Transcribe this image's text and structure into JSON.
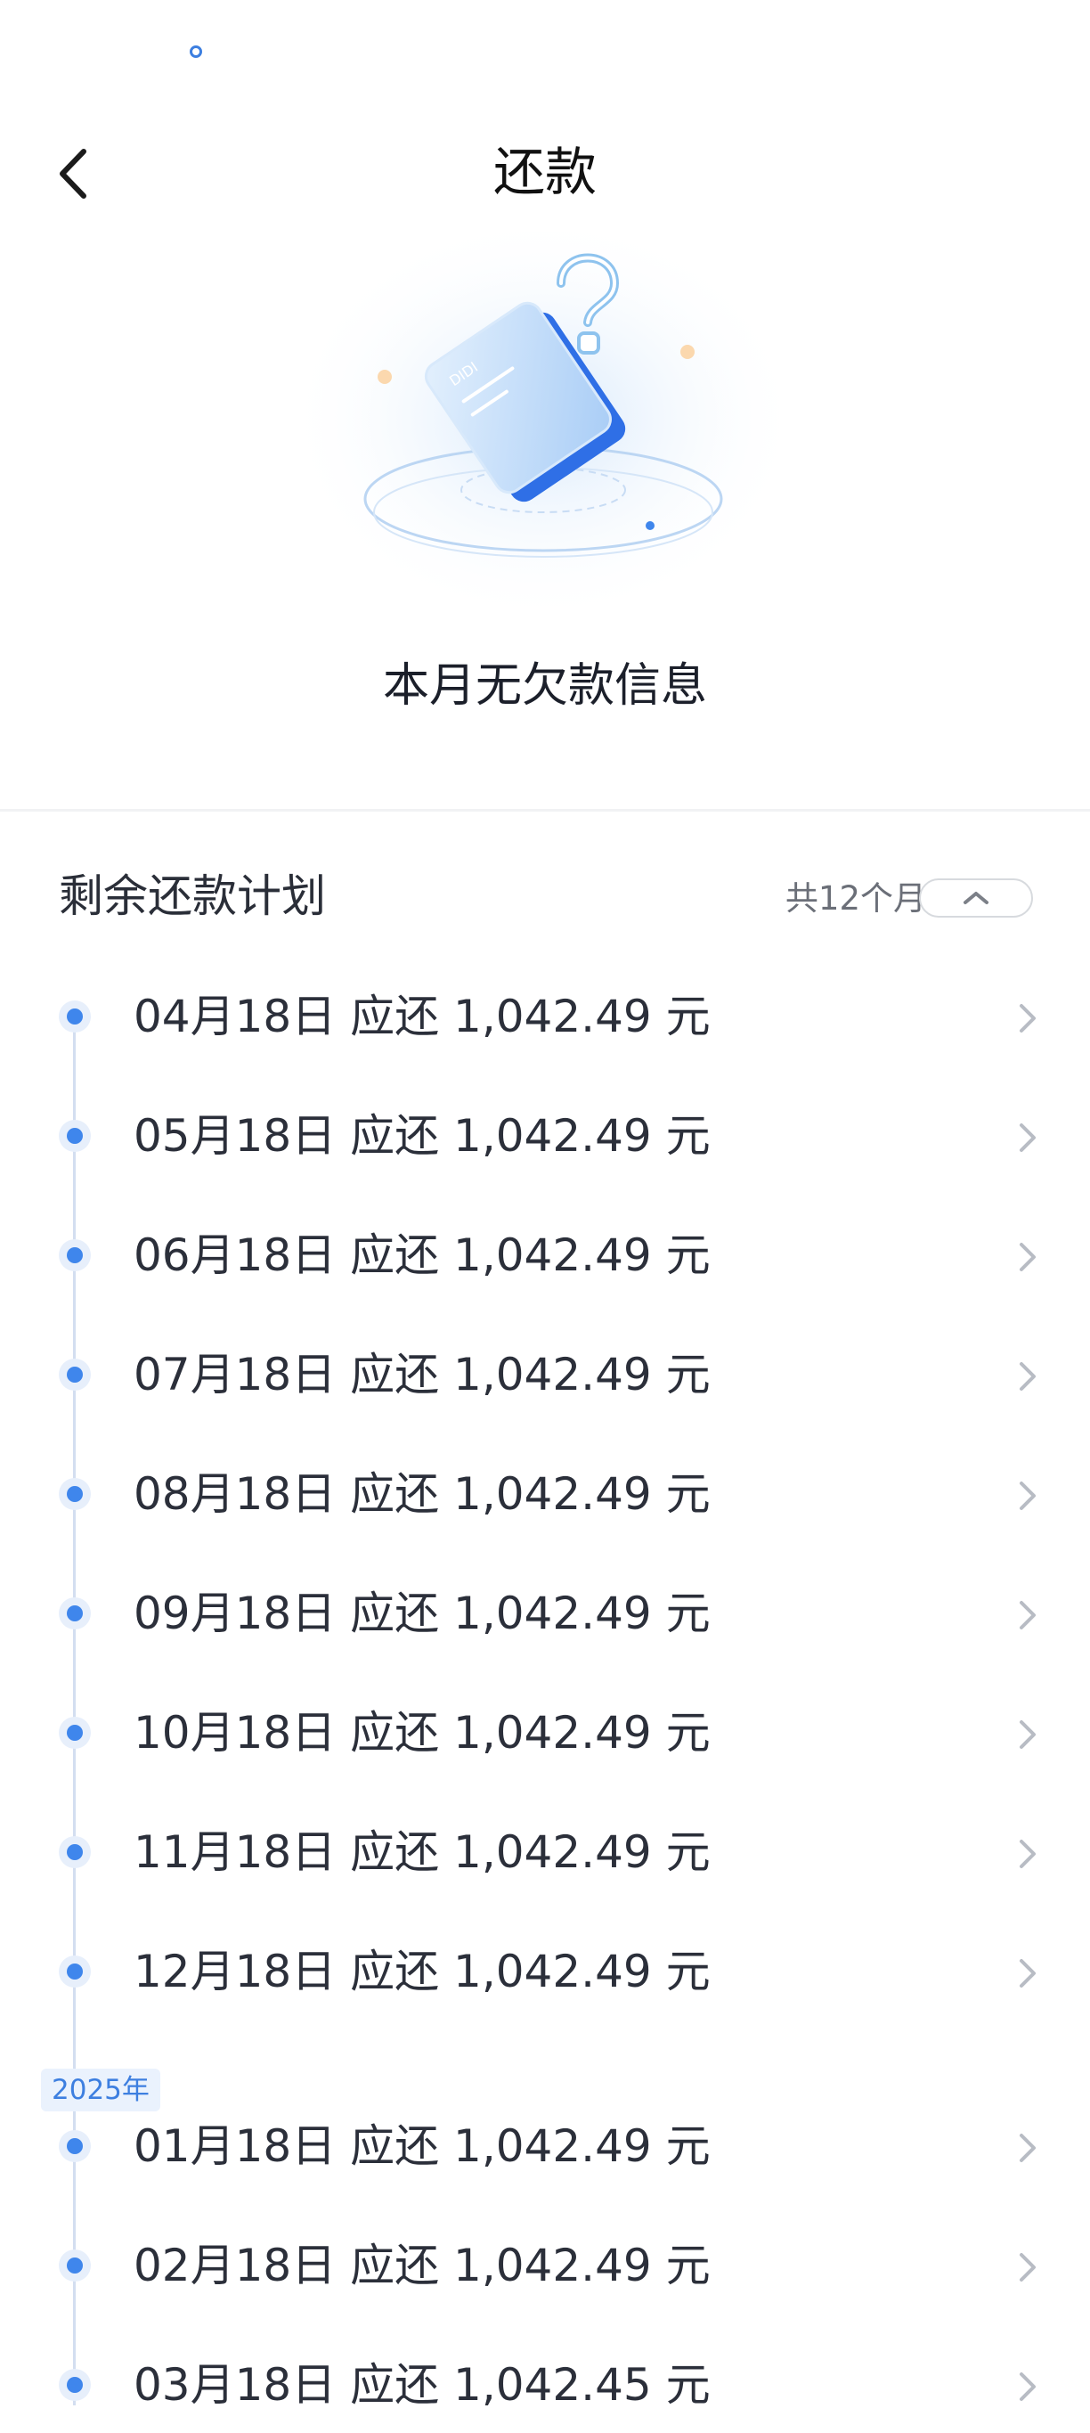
{
  "nav": {
    "title": "还款"
  },
  "empty_state": {
    "message": "本月无欠款信息",
    "illustration_label": "DIDI"
  },
  "plan": {
    "title": "剩余还款计划",
    "count": "共12个月"
  },
  "year_badge": "2025年",
  "schedule": [
    {
      "text": "04月18日 应还 1,042.49 元"
    },
    {
      "text": "05月18日 应还 1,042.49 元"
    },
    {
      "text": "06月18日 应还 1,042.49 元"
    },
    {
      "text": "07月18日 应还 1,042.49 元"
    },
    {
      "text": "08月18日 应还 1,042.49 元"
    },
    {
      "text": "09月18日 应还 1,042.49 元"
    },
    {
      "text": "10月18日 应还 1,042.49 元"
    },
    {
      "text": "11月18日 应还 1,042.49 元"
    },
    {
      "text": "12月18日 应还 1,042.49 元"
    },
    {
      "text": "01月18日 应还 1,042.49 元"
    },
    {
      "text": "02月18日 应还 1,042.49 元"
    },
    {
      "text": "03月18日 应还 1,042.45 元"
    }
  ],
  "colors": {
    "accent": "#3f86ec",
    "timeline": "#d3def0",
    "text": "#2b2f3a",
    "chevron": "#b8bcc4"
  },
  "icons": {
    "back": "chevron-left-icon",
    "row": "chevron-right-icon",
    "toggle": "chevron-up-icon"
  }
}
